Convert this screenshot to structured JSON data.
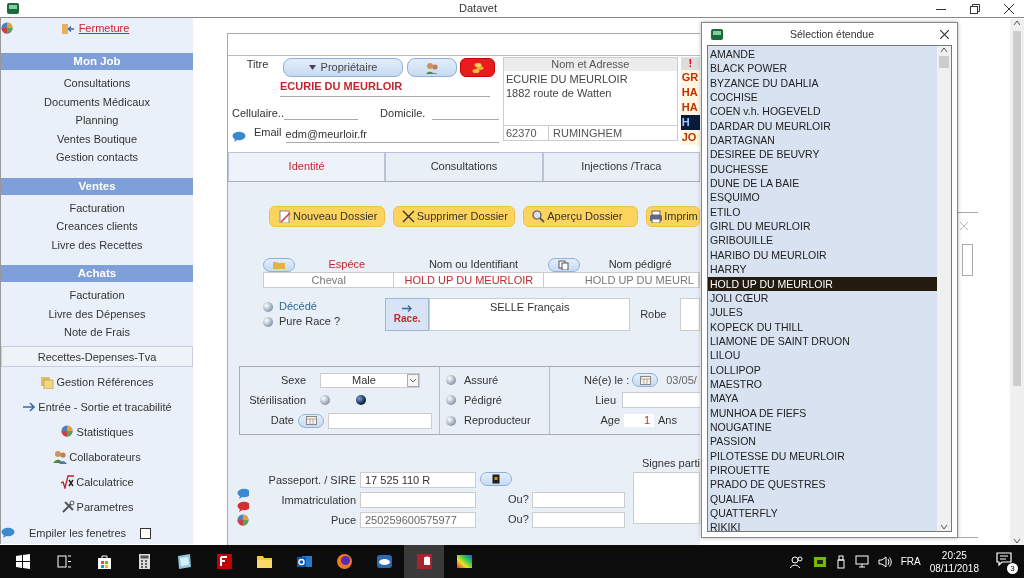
{
  "window": {
    "title": "Datavet"
  },
  "sidebar": {
    "close_link": "Fermeture",
    "sections": [
      {
        "title": "Mon Job",
        "items": [
          "Consultations",
          "Documents Médicaux",
          "Planning",
          "Ventes Boutique",
          "Gestion contacts"
        ]
      },
      {
        "title": "Ventes",
        "items": [
          "Facturation",
          "Creances clients",
          "Livre des Recettes"
        ]
      },
      {
        "title": "Achats",
        "items": [
          "Facturation",
          "Livre des Dépenses",
          "Note de Frais"
        ]
      }
    ],
    "report_button": "Recettes-Depenses-Tva",
    "tools": [
      {
        "label": "Gestion Références",
        "kind": "references"
      },
      {
        "label": "Entrée - Sortie et tracabilité",
        "kind": "arrow"
      },
      {
        "label": "Statistiques",
        "kind": "pie"
      },
      {
        "label": "Collaborateurs",
        "kind": "people"
      },
      {
        "label": "Calculatrice",
        "kind": "root"
      },
      {
        "label": "Parametres",
        "kind": "tools"
      }
    ],
    "stack_windows": {
      "label": "Empiler les fenetres",
      "checked": false
    }
  },
  "owner": {
    "title_label": "Titre",
    "type_button": "Propriétaire",
    "name": "ECURIE DU MEURLOIR",
    "cell_label": "Cellulaire..",
    "home_label": "Domicile.",
    "email_label": "Email",
    "email": "edm@meurloir.fr"
  },
  "address": {
    "header": "Nom et Adresse",
    "lines": [
      "ECURIE DU MEURLOIR",
      "1882 route de Watten"
    ],
    "postcode": "62370",
    "city": "RUMINGHEM"
  },
  "animals": {
    "header": "!",
    "items": [
      {
        "text": "GR",
        "selected": false
      },
      {
        "text": "HA",
        "selected": false
      },
      {
        "text": "HA",
        "selected": false
      },
      {
        "text": "H",
        "selected": true
      },
      {
        "text": "JO",
        "selected": false
      }
    ]
  },
  "tabs": [
    {
      "label": "Identité",
      "selected": true
    },
    {
      "label": "Consultations",
      "selected": false
    },
    {
      "label": "Injections /Traca",
      "selected": false
    }
  ],
  "actions": [
    {
      "label": "Nouveau Dossier",
      "kind": "new"
    },
    {
      "label": "Supprimer Dossier",
      "kind": "delete"
    },
    {
      "label": "Aperçu Dossier",
      "kind": "preview"
    },
    {
      "label": "Imprim",
      "kind": "print"
    }
  ],
  "animal": {
    "species_label": "Espéce",
    "species": "Cheval",
    "id_label": "Nom ou Identifiant",
    "id": "HOLD UP DU MEURLOIR",
    "pedigree_label": "Nom pédigré",
    "pedigree": "HOLD UP DU MEURL",
    "deceased": {
      "label": "Décédé",
      "checked": false
    },
    "pure_race": {
      "label": "Pure Race ?",
      "checked": false
    },
    "race_button": "Race.",
    "race": "SELLE Français",
    "robe_label": "Robe",
    "sex_label": "Sexe",
    "sex": "Male",
    "sterilisation": {
      "label": "Stérilisation",
      "options": [
        {
          "selected": false
        },
        {
          "selected": true
        }
      ]
    },
    "date_label": "Date",
    "flags": [
      {
        "label": "Assuré",
        "checked": false
      },
      {
        "label": "Pédigré",
        "checked": false
      },
      {
        "label": "Reproducteur",
        "checked": false
      }
    ],
    "birth_label": "Né(e) le :",
    "birth_date": "03/05/",
    "place_label": "Lieu",
    "age_label": "Age",
    "age": "1",
    "age_unit": "Ans",
    "passport_label": "Passeport. / SIRE",
    "passport": "17 525 110 R",
    "registration_label": "Immatriculation",
    "where_label_1": "Ou?",
    "chip_label": "Puce",
    "chip": "250259600575977",
    "where_label_2": "Ou?",
    "marks_label": "Signes parti"
  },
  "popup": {
    "title": "Sélection étendue",
    "items": [
      {
        "text": "AMANDE",
        "selected": false
      },
      {
        "text": "BLACK POWER",
        "selected": false
      },
      {
        "text": "BYZANCE DU DAHLIA",
        "selected": false
      },
      {
        "text": "COCHISE",
        "selected": false
      },
      {
        "text": "COEN v.h. HOGEVELD",
        "selected": false
      },
      {
        "text": "DARDAR DU MEURLOIR",
        "selected": false
      },
      {
        "text": "DARTAGNAN",
        "selected": false
      },
      {
        "text": "DESIREE DE BEUVRY",
        "selected": false
      },
      {
        "text": "DUCHESSE",
        "selected": false
      },
      {
        "text": "DUNE DE LA BAIE",
        "selected": false
      },
      {
        "text": "ESQUIMO",
        "selected": false
      },
      {
        "text": "ETILO",
        "selected": false
      },
      {
        "text": "GIRL DU MEURLOIR",
        "selected": false
      },
      {
        "text": "GRIBOUILLE",
        "selected": false
      },
      {
        "text": "HARIBO DU MEURLOIR",
        "selected": false
      },
      {
        "text": "HARRY",
        "selected": false
      },
      {
        "text": "HOLD UP DU MEURLOIR",
        "selected": true
      },
      {
        "text": "JOLI CŒUR",
        "selected": false
      },
      {
        "text": "JULES",
        "selected": false
      },
      {
        "text": "KOPECK DU THILL",
        "selected": false
      },
      {
        "text": "LIAMONE DE SAINT DRUON",
        "selected": false
      },
      {
        "text": "LILOU",
        "selected": false
      },
      {
        "text": "LOLLIPOP",
        "selected": false
      },
      {
        "text": "MAESTRO",
        "selected": false
      },
      {
        "text": "MAYA",
        "selected": false
      },
      {
        "text": "MUNHOA DE FIEFS",
        "selected": false
      },
      {
        "text": "NOUGATINE",
        "selected": false
      },
      {
        "text": "PASSION",
        "selected": false
      },
      {
        "text": "PILOTESSE DU MEURLOIR",
        "selected": false
      },
      {
        "text": "PIROUETTE",
        "selected": false
      },
      {
        "text": "PRADO DE QUESTRES",
        "selected": false
      },
      {
        "text": "QUALIFA",
        "selected": false
      },
      {
        "text": "QUATTERFLY",
        "selected": false
      },
      {
        "text": "RIKIKI",
        "selected": false
      }
    ]
  },
  "taskbar": {
    "language": "FRA",
    "time": "20:25",
    "date": "08/11/2018",
    "notifications": "3"
  }
}
